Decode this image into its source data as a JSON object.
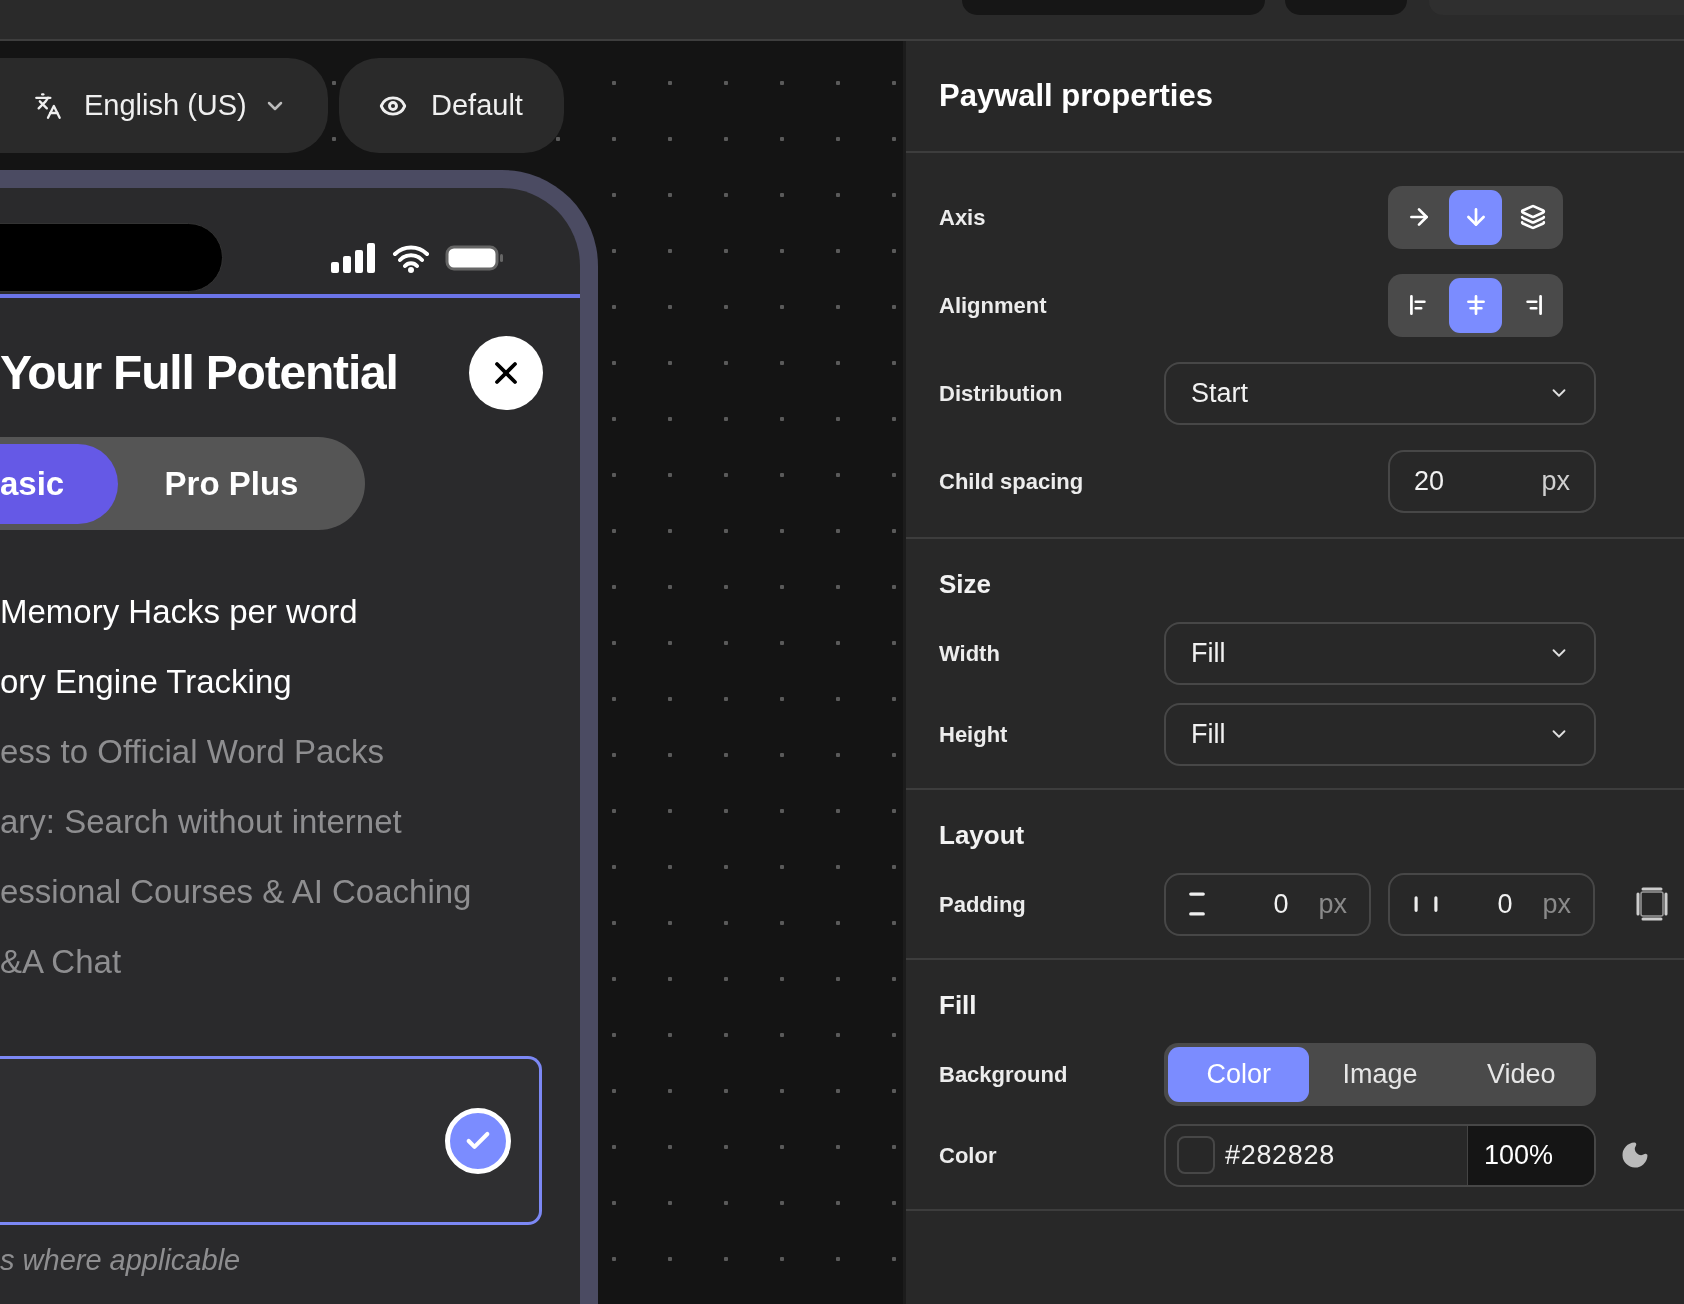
{
  "canvas": {
    "language_selector": {
      "value": "English (US)"
    },
    "preview_selector": {
      "value": "Default"
    }
  },
  "phone": {
    "title": "Your Full Potential",
    "plans": [
      {
        "label": "asic",
        "selected": true
      },
      {
        "label": "Pro Plus",
        "selected": false
      }
    ],
    "features": [
      {
        "text": "Memory Hacks per word",
        "included": true
      },
      {
        "text": "ory Engine Tracking",
        "included": true
      },
      {
        "text": "ess to Official Word Packs",
        "included": false
      },
      {
        "text": "ary: Search without internet",
        "included": false
      },
      {
        "text": "essional Courses & AI Coaching",
        "included": false
      },
      {
        "text": "&A Chat",
        "included": false
      }
    ],
    "plan_card": {
      "selected": true
    },
    "footnote": "s where applicable"
  },
  "panel": {
    "title": "Paywall properties",
    "sections": [
      {
        "rows": [
          {
            "kind": "icon-toggle",
            "label": "Axis",
            "options": [
              {
                "selected": false
              },
              {
                "selected": true
              },
              {
                "selected": false
              }
            ]
          },
          {
            "kind": "icon-toggle",
            "label": "Alignment",
            "options": [
              {
                "selected": false
              },
              {
                "selected": true
              },
              {
                "selected": false
              }
            ]
          },
          {
            "kind": "dropdown",
            "label": "Distribution",
            "value": "Start"
          },
          {
            "kind": "number",
            "label": "Child spacing",
            "value": "20",
            "unit": "px"
          }
        ]
      },
      {
        "heading": "Size",
        "rows": [
          {
            "kind": "dropdown",
            "label": "Width",
            "value": "Fill"
          },
          {
            "kind": "dropdown",
            "label": "Height",
            "value": "Fill"
          }
        ]
      },
      {
        "heading": "Layout",
        "rows": [
          {
            "kind": "padding",
            "label": "Padding",
            "fields": [
              {
                "value": "0",
                "unit": "px"
              },
              {
                "value": "0",
                "unit": "px"
              }
            ]
          }
        ]
      },
      {
        "heading": "Fill",
        "rows": [
          {
            "kind": "tabs",
            "label": "Background",
            "options": [
              {
                "label": "Color",
                "selected": true
              },
              {
                "label": "Image",
                "selected": false
              },
              {
                "label": "Video",
                "selected": false
              }
            ]
          },
          {
            "kind": "color",
            "label": "Color",
            "value": "#282828",
            "opacity": "100%"
          }
        ]
      }
    ]
  }
}
